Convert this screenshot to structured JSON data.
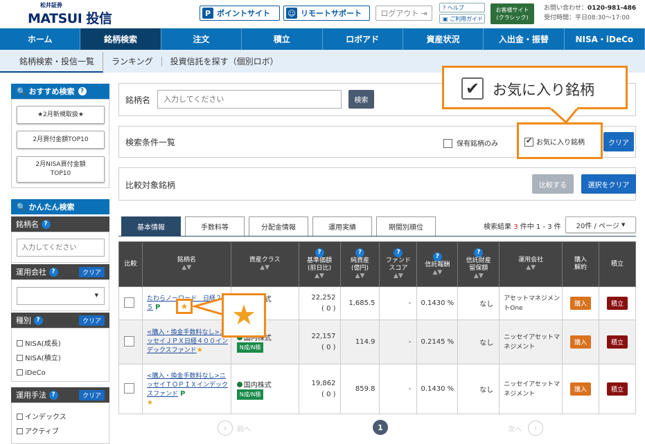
{
  "header": {
    "logo_small": "松井証券",
    "logo_brand": "MATSUI",
    "logo_suffix": "投信",
    "point_site": "ポイントサイト",
    "remote_support": "リモートサポート",
    "login": "ログアウト",
    "help": "ヘルプ",
    "guide": "ご利用ガイド",
    "classic_line1": "お客様サイト",
    "classic_line2": "(クラシック)",
    "contact_label": "お問い合わせ：",
    "contact_phone": "0120-981-486",
    "hours": "受付時間：平日08:30～17:00"
  },
  "nav": [
    "ホーム",
    "銘柄検索",
    "注文",
    "積立",
    "ロボアド",
    "資産状況",
    "入出金・振替",
    "NISA・iDeCo"
  ],
  "subnav": [
    "銘柄検索・投信一覧",
    "ランキング",
    "投資信託を探す（個別ロボ）"
  ],
  "sidebar": {
    "rec_title": "おすすめ検索",
    "rec_buttons": [
      "★2月新規取扱★",
      "2月買付金額TOP10",
      "2月NISA買付金額",
      "TOP10"
    ],
    "easy_title": "かんたん検索",
    "name_label": "銘柄名",
    "name_placeholder": "入力してください",
    "company_label": "運用会社",
    "clear": "クリア",
    "type_label": "種別",
    "types": [
      "NISA(成長)",
      "NISA(積立)",
      "iDeCo"
    ],
    "method_label": "運用手法",
    "methods": [
      "インデックス",
      "アクティブ"
    ]
  },
  "search": {
    "label": "銘柄名",
    "placeholder": "入力してください",
    "button": "検索"
  },
  "conditions": {
    "label": "検索条件一覧",
    "owned": "保有銘柄のみ",
    "favorite": "お気に入り銘柄",
    "clear": "クリア"
  },
  "compare": {
    "label": "比較対象銘柄",
    "compare_btn": "比較する",
    "clear_btn": "選択をクリア"
  },
  "callout": {
    "text": "お気に入り銘柄"
  },
  "tabs": [
    "基本情報",
    "手数料等",
    "分配金情報",
    "運用実績",
    "期間別順位"
  ],
  "results": {
    "prefix": "検索結果",
    "count": "3",
    "suffix": "件中 1 - 3 件",
    "per_page": "20件 / ページ"
  },
  "table": {
    "headers": [
      "比較",
      "銘柄名",
      "資産クラス",
      "基準価額\n(前日比)",
      "純資産\n(億円)",
      "ファンド\nスコア",
      "信託報酬",
      "信託財産\n留保額",
      "運用会社",
      "購入\n解約",
      "積立"
    ],
    "rows": [
      {
        "name": "たわらノーロード　日経２２５",
        "asset": "国内株式",
        "badge": "N積",
        "price": "22,252",
        "change": "( 0 )",
        "net": "1,685.5",
        "score": "-",
        "fee": "0.1430 %",
        "reserve": "なし",
        "company": "アセットマネジメントOne",
        "buy": "購入",
        "tsumitate": "積立"
      },
      {
        "name": "<購入・換金手数料なし>ニッセイＪＰＸ日経４００インデックスファンド",
        "asset": "国内株式",
        "badge": "N成/N積",
        "price": "22,157",
        "change": "( 0 )",
        "net": "114.9",
        "score": "-",
        "fee": "0.2145 %",
        "reserve": "なし",
        "company": "ニッセイアセットマネジメント",
        "buy": "購入",
        "tsumitate": "積立"
      },
      {
        "name": "<購入・換金手数料なし>ニッセイＴＯＰＩＸインデックスファンド",
        "asset": "国内株式",
        "badge": "N成/N積",
        "price": "19,862",
        "change": "( 0 )",
        "net": "859.8",
        "score": "-",
        "fee": "0.1430 %",
        "reserve": "なし",
        "company": "ニッセイアセットマネジメント",
        "buy": "購入",
        "tsumitate": "積立"
      }
    ]
  },
  "pagination": {
    "page": "1",
    "prev": "前へ",
    "next": "次へ"
  },
  "colors": {
    "nav": "#0a70b8",
    "callout_border": "#f08a1a",
    "star": "#f0a020"
  }
}
